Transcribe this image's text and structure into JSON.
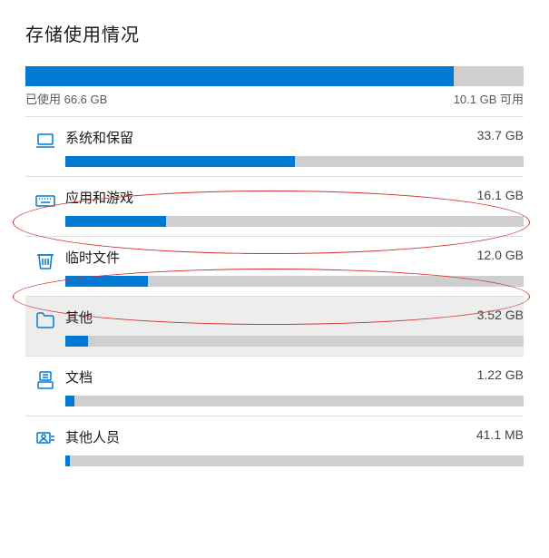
{
  "title": "存储使用情况",
  "usedLabel": "已使用 66.6 GB",
  "freeLabel": "10.1 GB 可用",
  "totalFillPercent": 86,
  "categories": [
    {
      "name": "系统和保留",
      "size": "33.7 GB",
      "percent": 50,
      "icon": "laptop-icon",
      "highlighted": false
    },
    {
      "name": "应用和游戏",
      "size": "16.1 GB",
      "percent": 22,
      "icon": "keyboard-icon",
      "highlighted": false
    },
    {
      "name": "临时文件",
      "size": "12.0 GB",
      "percent": 18,
      "icon": "trash-icon",
      "highlighted": false
    },
    {
      "name": "其他",
      "size": "3.52 GB",
      "percent": 5,
      "icon": "folder-icon",
      "highlighted": true
    },
    {
      "name": "文档",
      "size": "1.22 GB",
      "percent": 2,
      "icon": "documents-icon",
      "highlighted": false
    },
    {
      "name": "其他人员",
      "size": "41.1 MB",
      "percent": 1,
      "icon": "people-icon",
      "highlighted": false
    }
  ]
}
